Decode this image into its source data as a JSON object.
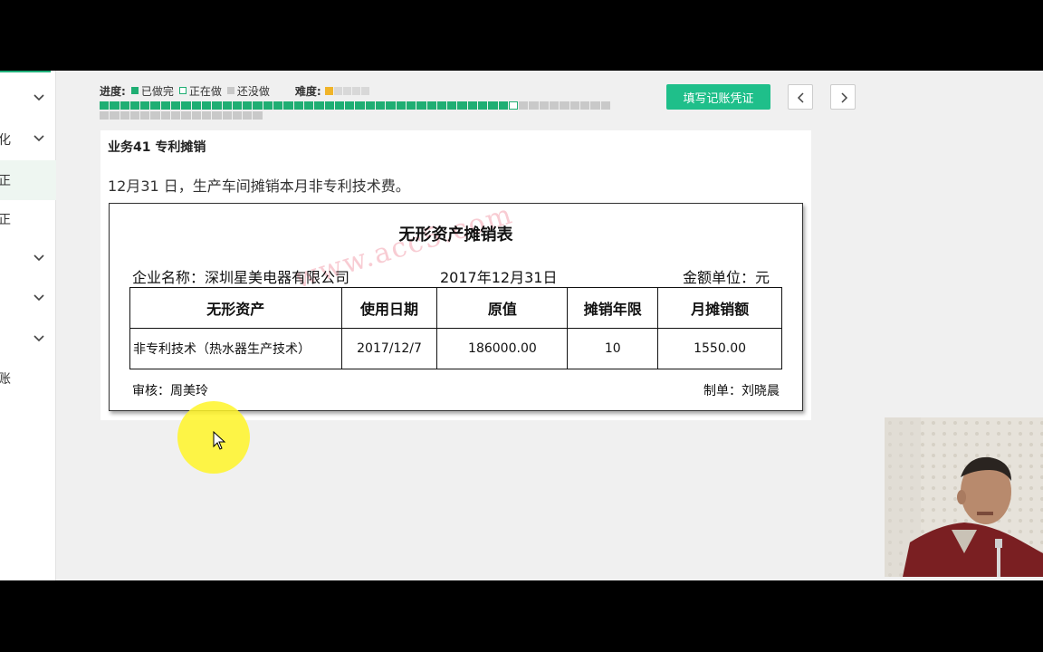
{
  "sidebar": {
    "items": [
      {
        "fragment": "",
        "chevron": true,
        "active": false
      },
      {
        "fragment": "化",
        "chevron": true,
        "active": false
      },
      {
        "fragment": "正",
        "chevron": false,
        "active": true
      },
      {
        "fragment": "正",
        "chevron": false,
        "active": false
      },
      {
        "fragment": "",
        "chevron": true,
        "active": false
      },
      {
        "fragment": "",
        "chevron": true,
        "active": false
      },
      {
        "fragment": "",
        "chevron": true,
        "active": false
      },
      {
        "fragment": "账",
        "chevron": false,
        "active": false
      }
    ]
  },
  "progress": {
    "label": "进度:",
    "legend_done": "已做完",
    "legend_doing": "正在做",
    "legend_todo": "还没做",
    "difficulty_label": "难度:",
    "difficulty_stars": 1,
    "difficulty_max": 5,
    "done_count": 40,
    "current_index": 41,
    "total_count": 66
  },
  "toolbar": {
    "fill_voucher_label": "填写记账凭证",
    "prev_icon": "chevron-left-icon",
    "next_icon": "chevron-right-icon"
  },
  "task": {
    "title": "业务41 专利摊销",
    "description": "12月31 日，生产车间摊销本月非专利技术费。"
  },
  "form": {
    "title": "无形资产摊销表",
    "company": "企业名称：深圳星美电器有限公司",
    "date": "2017年12月31日",
    "unit": "金额单位：元",
    "headers": [
      "无形资产",
      "使用日期",
      "原值",
      "摊销年限",
      "月摊销额"
    ],
    "rows": [
      [
        "非专利技术（热水器生产技术）",
        "2017/12/7",
        "186000.00",
        "10",
        "1550.00"
      ]
    ],
    "reviewer": "审核：周美玲",
    "preparer": "制单：刘晓晨",
    "watermark": "www.acc5.com"
  },
  "colors": {
    "accent": "#1fbf8a",
    "done": "#1fae73",
    "todo": "#c9c9c9"
  }
}
